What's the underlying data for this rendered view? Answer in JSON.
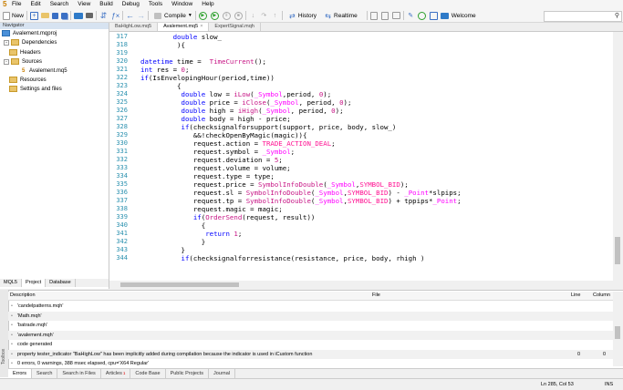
{
  "app": {
    "logo": "5"
  },
  "menu": [
    "File",
    "Edit",
    "Search",
    "View",
    "Build",
    "Debug",
    "Tools",
    "Window",
    "Help"
  ],
  "toolbar": {
    "new_label": "New",
    "compile_label": "Compile",
    "history_label": "History",
    "realtime_label": "Realtime",
    "welcome_label": "Welcome"
  },
  "navigator": {
    "title": "Navigator",
    "items": [
      {
        "label": "Avalement.mqproj"
      },
      {
        "label": "Dependencies"
      },
      {
        "label": "Headers"
      },
      {
        "label": "Sources"
      },
      {
        "label": "Avalement.mq5"
      },
      {
        "label": "Resources"
      },
      {
        "label": "Settings and files"
      }
    ],
    "tabs": [
      "MQL5",
      "Project",
      "Database"
    ]
  },
  "editor_tabs": [
    {
      "label": "BaHighLow.mq5"
    },
    {
      "label": "Avalement.mq5"
    },
    {
      "label": "ExpertSignal.mqh"
    }
  ],
  "line_numbers": [
    "317",
    "318",
    "319",
    "320",
    "321",
    "322",
    "323",
    "324",
    "325",
    "326",
    "327",
    "328",
    "329",
    "330",
    "331",
    "332",
    "333",
    "334",
    "335",
    "336",
    "337",
    "338",
    "339",
    "340",
    "341",
    "342",
    "343",
    "344"
  ],
  "code_lines": [
    "        double slow_",
    "         ){",
    "",
    "datetime time =  TimeCurrent();",
    "int res = 0;",
    "if(IsEnvelopingHour(period,time))",
    "         {",
    "          double low = iLow(_Symbol,period, 0);",
    "          double price = iClose(_Symbol, period, 0);",
    "          double high = iHigh(_Symbol, period, 0);",
    "          double body = high - price;",
    "          if(checksignalforsupport(support, price, body, slow_)",
    "             &&!checkOpenByMagic(magic)){",
    "             request.action = TRADE_ACTION_DEAL;",
    "             request.symbol = _Symbol;",
    "             request.deviation = 5;",
    "             request.volume = volume;",
    "             request.type = type;",
    "             request.price = SymbolInfoDouble(_Symbol,SYMBOL_BID);",
    "             request.sl = SymbolInfoDouble(_Symbol,SYMBOL_BID) - _Point*slpips;",
    "             request.tp = SymbolInfoDouble(_Symbol,SYMBOL_BID) + tppips*_Point;",
    "             request.magic = magic;",
    "             if(OrderSend(request, result))",
    "               {",
    "                return 1;",
    "               }",
    "          }",
    "          if(checksignalforresistance(resistance, price, body, rhigh )"
  ],
  "errors": {
    "columns": {
      "description": "Description",
      "file": "File",
      "line": "Line",
      "column": "Column"
    },
    "rows": [
      {
        "description": "'candelpatterns.mqh'",
        "file": "",
        "line": "",
        "column": ""
      },
      {
        "description": "'Math.mqh'",
        "file": "",
        "line": "",
        "column": ""
      },
      {
        "description": "'batrade.mqh'",
        "file": "",
        "line": "",
        "column": ""
      },
      {
        "description": "'avalement.mqh'",
        "file": "",
        "line": "",
        "column": ""
      },
      {
        "description": "code generated",
        "file": "",
        "line": "",
        "column": ""
      },
      {
        "description": "property tester_indicator \"BaHighLow\" has been implicitly added during compilation because the indicator is used in iCustom function",
        "file": "",
        "line": "0",
        "column": "0"
      },
      {
        "description": "0 errors, 0 warnings, 388 msec elapsed, cpu='X64 Regular'",
        "file": "",
        "line": "",
        "column": ""
      }
    ]
  },
  "toolbox": {
    "label": "Toolbox"
  },
  "bottom_tabs": [
    {
      "label": "Errors"
    },
    {
      "label": "Search"
    },
    {
      "label": "Search in Files"
    },
    {
      "label": "Articles",
      "badge": "1"
    },
    {
      "label": "Code Base"
    },
    {
      "label": "Public Projects"
    },
    {
      "label": "Journal"
    }
  ],
  "status": {
    "position": "Ln 285, Col 53",
    "mode": "INS"
  }
}
